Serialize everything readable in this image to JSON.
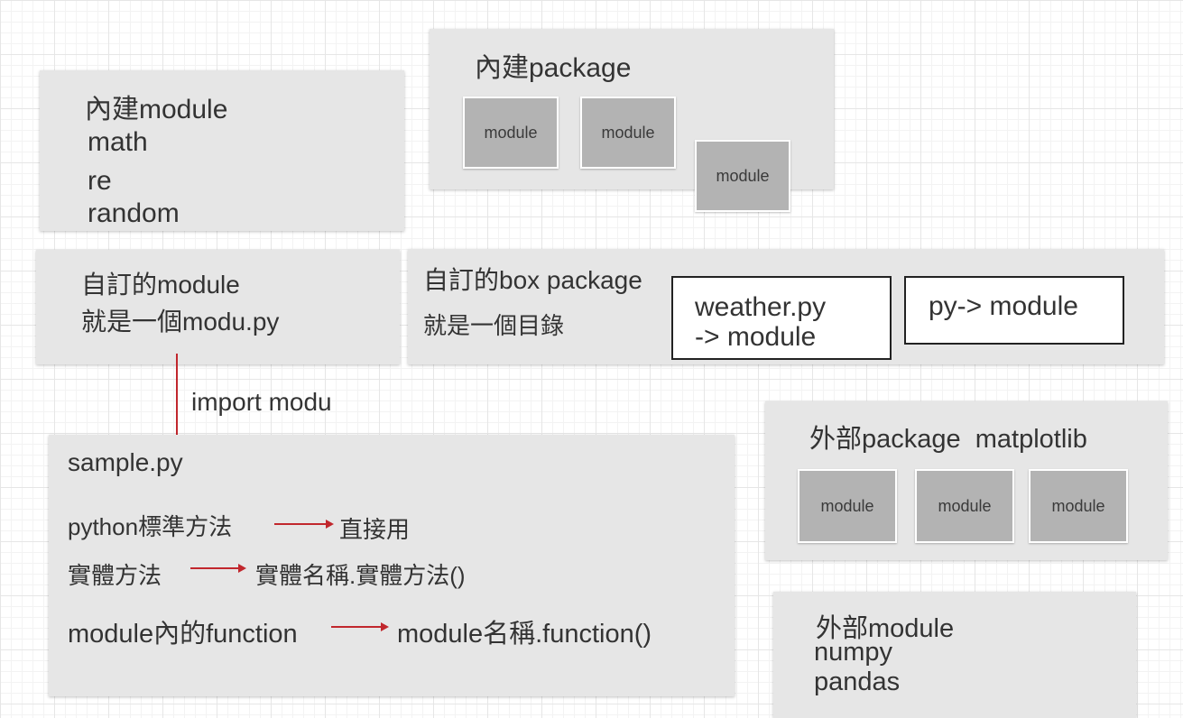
{
  "builtin_module": {
    "title": "內建module",
    "items": [
      "math",
      "re",
      "random"
    ]
  },
  "builtin_package": {
    "title": "內建package",
    "modules": [
      "module",
      "module",
      "module"
    ]
  },
  "custom_module": {
    "title": "自訂的module",
    "subtitle": "就是一個modu.py"
  },
  "custom_package": {
    "title": "自訂的box package",
    "subtitle": "就是一個目錄",
    "box1_line1": "weather.py",
    "box1_line2": "-> module",
    "box2": "py-> module"
  },
  "import_label": "import modu",
  "sample": {
    "title": "sample.py",
    "rows": [
      {
        "left": "python標準方法",
        "right": "直接用"
      },
      {
        "left": "實體方法",
        "right": "實體名稱.實體方法()"
      },
      {
        "left": "module內的function",
        "right": "module名稱.function()"
      }
    ]
  },
  "external_package": {
    "title": "外部package  matplotlib",
    "modules": [
      "module",
      "module",
      "module"
    ]
  },
  "external_module": {
    "title": "外部module",
    "items": [
      "numpy",
      "pandas"
    ]
  },
  "colors": {
    "panel": "#e6e6e6",
    "module_box": "#b3b3b3",
    "arrow": "#c1272d"
  }
}
